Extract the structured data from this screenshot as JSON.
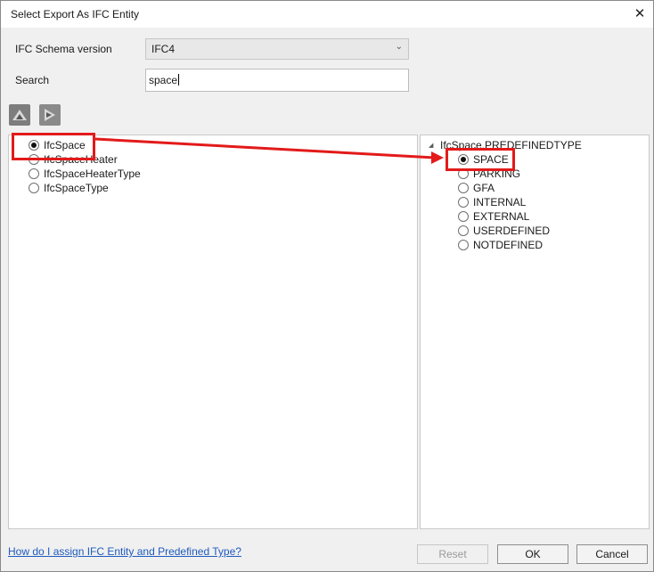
{
  "dialog": {
    "title": "Select Export As IFC Entity",
    "close_glyph": "✕"
  },
  "schema": {
    "label": "IFC Schema version",
    "selected": "IFC4",
    "chevron_glyph": "⌄"
  },
  "search": {
    "label": "Search",
    "value": "space"
  },
  "toolbar": {
    "expand_icon": "expand-all-icon",
    "collapse_icon": "collapse-all-icon"
  },
  "entities": [
    {
      "label": "IfcSpace",
      "selected": true
    },
    {
      "label": "IfcSpaceHeater",
      "selected": false
    },
    {
      "label": "IfcSpaceHeaterType",
      "selected": false
    },
    {
      "label": "IfcSpaceType",
      "selected": false
    }
  ],
  "predefined": {
    "node_label": "IfcSpace.PREDEFINEDTYPE",
    "tree_glyph": "◢",
    "types": [
      {
        "label": "SPACE",
        "selected": true
      },
      {
        "label": "PARKING",
        "selected": false
      },
      {
        "label": "GFA",
        "selected": false
      },
      {
        "label": "INTERNAL",
        "selected": false
      },
      {
        "label": "EXTERNAL",
        "selected": false
      },
      {
        "label": "USERDEFINED",
        "selected": false
      },
      {
        "label": "NOTDEFINED",
        "selected": false
      }
    ]
  },
  "footer": {
    "help_link": "How do I assign IFC Entity and Predefined Type?",
    "reset_label": "Reset",
    "ok_label": "OK",
    "cancel_label": "Cancel"
  },
  "colors": {
    "annotation_red": "#e31a1a",
    "link_blue": "#1f5bbf"
  }
}
